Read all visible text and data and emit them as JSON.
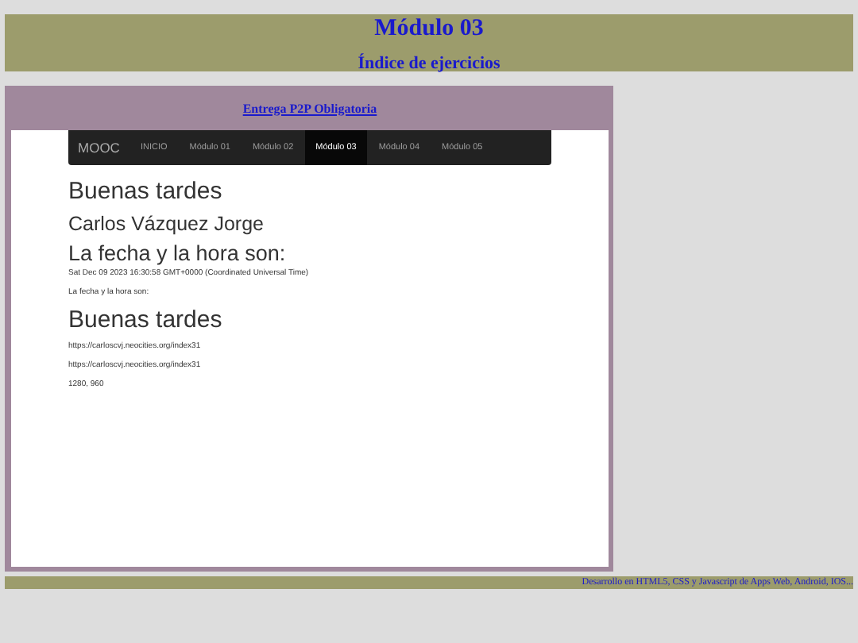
{
  "header": {
    "title": "Módulo 03",
    "subtitle": "Índice de ejercicios"
  },
  "panel": {
    "link": "Entrega P2P Obligatoria"
  },
  "navbar": {
    "brand": "MOOC",
    "items": [
      {
        "label": "INICIO",
        "selected": false
      },
      {
        "label": "Módulo 01",
        "selected": false
      },
      {
        "label": "Módulo 02",
        "selected": false
      },
      {
        "label": "Módulo 03",
        "selected": true
      },
      {
        "label": "Módulo 04",
        "selected": false
      },
      {
        "label": "Módulo 05",
        "selected": false
      }
    ]
  },
  "content": [
    {
      "kind": "large",
      "text": "Buenas tardes"
    },
    {
      "kind": "medium",
      "text": "Carlos Vázquez Jorge"
    },
    {
      "kind": "large2",
      "text": "La fecha y la hora son:"
    },
    {
      "kind": "small",
      "text": "Sat Dec 09 2023 16:30:58 GMT+0000 (Coordinated Universal Time)"
    },
    {
      "kind": "small",
      "text": "La fecha y la hora son:"
    },
    {
      "kind": "large",
      "text": "Buenas tardes"
    },
    {
      "kind": "small",
      "text": "https://carloscvj.neocities.org/index31"
    },
    {
      "kind": "small",
      "text": "https://carloscvj.neocities.org/index31"
    },
    {
      "kind": "small",
      "text": "1280, 960"
    }
  ],
  "footer": {
    "text": "Desarrollo en HTML5, CSS y Javascript de Apps Web, Android, IOS..."
  }
}
